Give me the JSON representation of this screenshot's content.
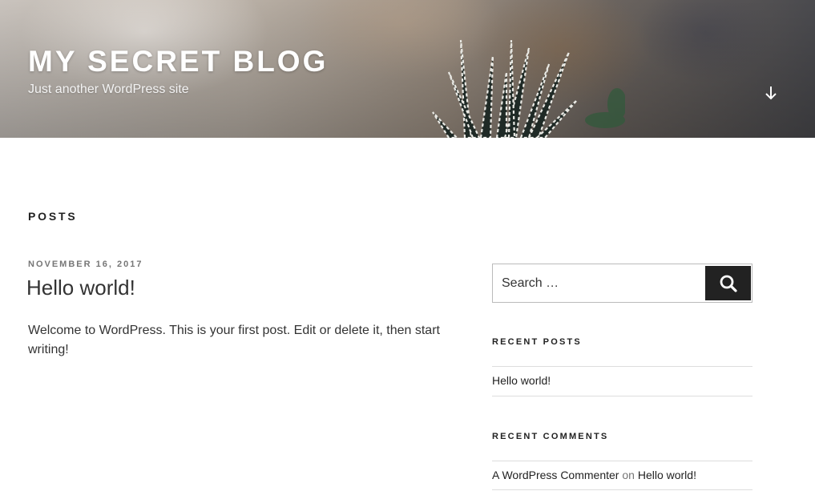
{
  "header": {
    "site_title": "MY SECRET BLOG",
    "tagline": "Just another WordPress site",
    "scroll_icon": "arrow-down-icon"
  },
  "main": {
    "section_title": "POSTS",
    "post": {
      "date": "NOVEMBER 16, 2017",
      "title": "Hello world!",
      "excerpt": "Welcome to WordPress. This is your first post. Edit or delete it, then start writing!"
    }
  },
  "sidebar": {
    "search": {
      "placeholder": "Search …",
      "button_icon": "search-icon"
    },
    "recent_posts": {
      "title": "RECENT POSTS",
      "items": [
        "Hello world!"
      ]
    },
    "recent_comments": {
      "title": "RECENT COMMENTS",
      "items": [
        {
          "author": "A WordPress Commenter",
          "connector": "on",
          "post": "Hello world!"
        }
      ]
    }
  },
  "colors": {
    "text_dark": "#222222",
    "text_body": "#333333",
    "meta_gray": "#767676",
    "button_bg": "#222222"
  }
}
